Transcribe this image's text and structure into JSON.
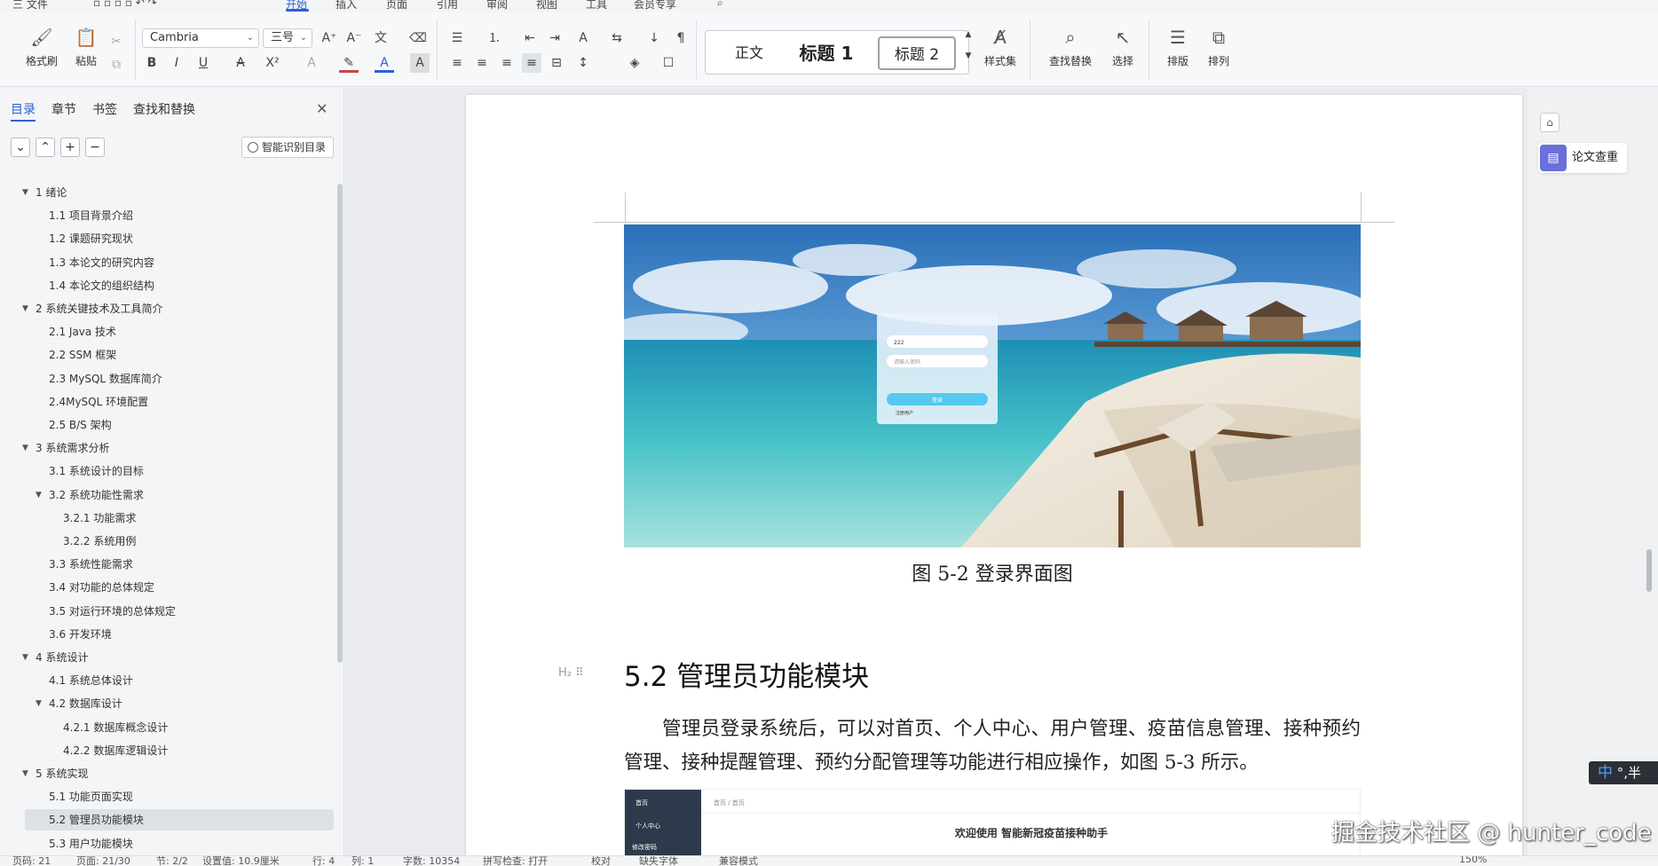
{
  "menubar": {
    "items": [
      "三 文件",
      "开始",
      "插入",
      "页面",
      "引用",
      "审阅",
      "视图",
      "工具",
      "会员专享"
    ],
    "active": "开始"
  },
  "ribbon": {
    "format_painter": "格式刷",
    "paste": "粘贴",
    "font_family": "Cambria",
    "font_size": "三号",
    "styles": [
      "正文",
      "标题 1",
      "标题 2"
    ],
    "selected_style": "标题 2",
    "style_set": "样式集",
    "find_replace": "查找替换",
    "select": "选择",
    "layout": "排版",
    "arrange": "排列"
  },
  "nav": {
    "tabs": [
      "目录",
      "章节",
      "书签",
      "查找和替换"
    ],
    "active_tab": "目录",
    "smart_toc": "智能识别目录",
    "items": [
      {
        "text": "1  绪论",
        "level": 0,
        "expanded": true
      },
      {
        "text": "1.1 项目背景介绍",
        "level": 1
      },
      {
        "text": "1.2 课题研究现状",
        "level": 1
      },
      {
        "text": "1.3 本论文的研究内容",
        "level": 1
      },
      {
        "text": "1.4 本论文的组织结构",
        "level": 1
      },
      {
        "text": "2 系统关键技术及工具简介",
        "level": 0,
        "expanded": true
      },
      {
        "text": "2.1 Java 技术",
        "level": 1
      },
      {
        "text": "2.2 SSM 框架",
        "level": 1
      },
      {
        "text": "2.3 MySQL 数据库简介",
        "level": 1
      },
      {
        "text": "2.4MySQL 环境配置",
        "level": 1
      },
      {
        "text": "2.5 B/S 架构",
        "level": 1
      },
      {
        "text": "3 系统需求分析",
        "level": 0,
        "expanded": true
      },
      {
        "text": "3.1 系统设计的目标",
        "level": 1
      },
      {
        "text": "3.2 系统功能性需求",
        "level": 1,
        "expanded": true
      },
      {
        "text": "3.2.1  功能需求",
        "level": 2
      },
      {
        "text": "3.2.2  系统用例",
        "level": 2
      },
      {
        "text": "3.3 系统性能需求",
        "level": 1
      },
      {
        "text": "3.4 对功能的总体规定",
        "level": 1
      },
      {
        "text": "3.5 对运行环境的总体规定",
        "level": 1
      },
      {
        "text": "3.6 开发环境",
        "level": 1
      },
      {
        "text": "4 系统设计",
        "level": 0,
        "expanded": true
      },
      {
        "text": "4.1 系统总体设计",
        "level": 1
      },
      {
        "text": "4.2 数据库设计",
        "level": 1,
        "expanded": true
      },
      {
        "text": "4.2.1  数据库概念设计",
        "level": 2
      },
      {
        "text": "4.2.2  数据库逻辑设计",
        "level": 2
      },
      {
        "text": "5 系统实现",
        "level": 0,
        "expanded": true
      },
      {
        "text": "5.1 功能页面实现",
        "level": 1
      },
      {
        "text": "5.2 管理员功能模块",
        "level": 1,
        "selected": true
      },
      {
        "text": "5.3 用户功能模块",
        "level": 1
      }
    ]
  },
  "document": {
    "figure_caption": "图 5-2 登录界面图",
    "heading_marker": "H₂",
    "heading": "5.2 管理员功能模块",
    "paragraph": "管理员登录系统后，可以对首页、个人中心、用户管理、疫苗信息管理、接种预约管理、接种提醒管理、预约分配管理等功能进行相应操作，如图 5-3 所示。",
    "login_form": {
      "username": "222",
      "password_placeholder": "请输入密码",
      "button": "登录",
      "register": "注册用户"
    },
    "fig2": {
      "breadcrumb": "首页  /  首页",
      "welcome": "欢迎使用 智能新冠疫苗接种助手",
      "menu": [
        "首页",
        "个人中心",
        "修改密码"
      ]
    }
  },
  "right_pane": {
    "paper_check": "论文查重"
  },
  "ime": {
    "mode": "中",
    "punct": "°,半"
  },
  "watermark": "掘金技术社区 @ hunter_code",
  "statusbar": {
    "items": [
      "页码: 21",
      "页面: 21/30",
      "节: 2/2",
      "设置值: 10.9厘米",
      "行: 4",
      "列: 1",
      "字数: 10354",
      "拼写检查: 打开",
      "校对",
      "缺失字体",
      "兼容模式",
      "150%"
    ]
  },
  "colors": {
    "accent": "#2b5fd9",
    "selected_bg": "#dde0e5",
    "paper_check_icon": "#6b6fd8"
  }
}
